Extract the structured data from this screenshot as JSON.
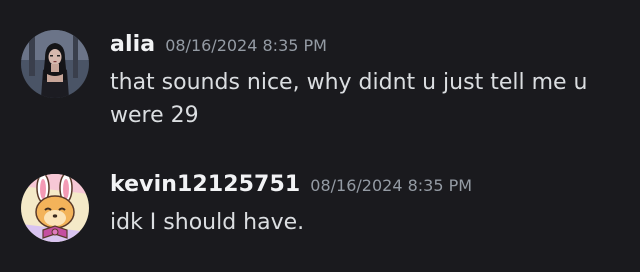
{
  "messages": [
    {
      "username": "alia",
      "timestamp": "08/16/2024 8:35 PM",
      "text": "that sounds nice, why didnt u just tell me u were 29",
      "avatar_icon": "user-photo-avatar"
    },
    {
      "username": "kevin12125751",
      "timestamp": "08/16/2024 8:35 PM",
      "text": "idk I should have.",
      "avatar_icon": "cartoon-bunny-avatar"
    }
  ],
  "colors": {
    "background": "#1a1a1e",
    "username": "#f2f3f5",
    "timestamp": "#949ba4",
    "message_text": "#dbdee1"
  }
}
